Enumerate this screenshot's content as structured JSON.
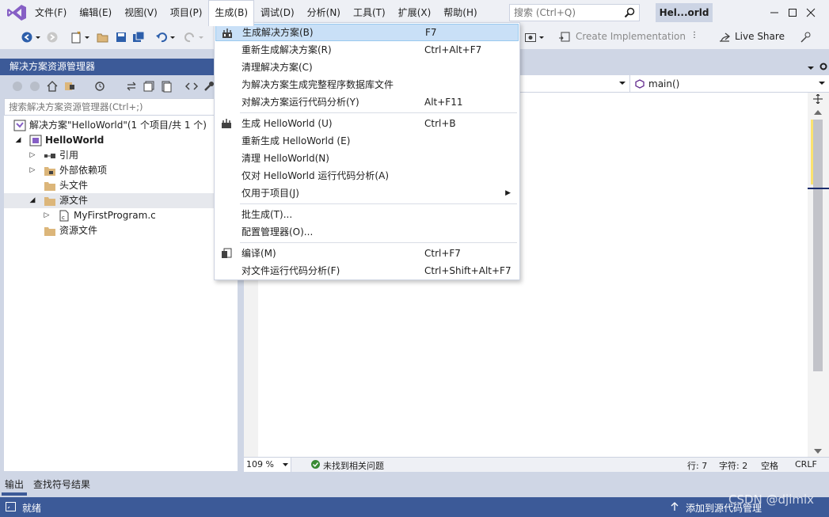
{
  "menu": {
    "items": [
      "文件(F)",
      "编辑(E)",
      "视图(V)",
      "项目(P)",
      "生成(B)",
      "调试(D)",
      "分析(N)",
      "工具(T)",
      "扩展(X)",
      "帮助(H)"
    ],
    "active_index": 4
  },
  "search": {
    "placeholder": "搜索 (Ctrl+Q)"
  },
  "title": "Hel...orld",
  "toolbar": {
    "create_impl": "Create Implementation",
    "live_share": "Live Share"
  },
  "solution_explorer": {
    "title": "解决方案资源管理器",
    "search_placeholder": "搜索解决方案资源管理器(Ctrl+;)",
    "tree": [
      {
        "label": "解决方案\"HelloWorld\"(1 个项目/共 1 个)",
        "icon": "solution-icon",
        "level": 0
      },
      {
        "label": "HelloWorld",
        "icon": "project-icon",
        "level": 0,
        "bold": true,
        "expanded": true
      },
      {
        "label": "引用",
        "icon": "references-icon",
        "level": 1,
        "expandable": true
      },
      {
        "label": "外部依赖项",
        "icon": "external-deps-icon",
        "level": 1,
        "expandable": true
      },
      {
        "label": "头文件",
        "icon": "folder-icon",
        "level": 1
      },
      {
        "label": "源文件",
        "icon": "folder-icon",
        "level": 1,
        "expanded": true,
        "selected": true
      },
      {
        "label": "MyFirstProgram.c",
        "icon": "c-file-icon",
        "level": 2,
        "expandable": true
      },
      {
        "label": "资源文件",
        "icon": "folder-icon",
        "level": 1
      }
    ]
  },
  "build_menu": [
    {
      "label": "生成解决方案(B)",
      "shortcut": "F7",
      "icon": "build-solution-icon",
      "highlighted": true
    },
    {
      "label": "重新生成解决方案(R)",
      "shortcut": "Ctrl+Alt+F7"
    },
    {
      "label": "清理解决方案(C)",
      "shortcut": ""
    },
    {
      "label": "为解决方案生成完整程序数据库文件",
      "shortcut": ""
    },
    {
      "label": "对解决方案运行代码分析(Y)",
      "shortcut": "Alt+F11"
    },
    {
      "separator": true
    },
    {
      "label": "生成 HelloWorld (U)",
      "shortcut": "Ctrl+B",
      "icon": "build-project-icon"
    },
    {
      "label": "重新生成 HelloWorld (E)",
      "shortcut": ""
    },
    {
      "label": "清理 HelloWorld(N)",
      "shortcut": ""
    },
    {
      "label": "仅对 HelloWorld 运行代码分析(A)",
      "shortcut": ""
    },
    {
      "label": "仅用于项目(J)",
      "shortcut": "",
      "submenu": true
    },
    {
      "separator": true
    },
    {
      "label": "批生成(T)...",
      "shortcut": ""
    },
    {
      "label": "配置管理器(O)...",
      "shortcut": ""
    },
    {
      "separator": true
    },
    {
      "label": "编译(M)",
      "shortcut": "Ctrl+F7",
      "icon": "compile-icon"
    },
    {
      "label": "对文件运行代码分析(F)",
      "shortcut": "Ctrl+Shift+Alt+F7"
    }
  ],
  "editor": {
    "function_dropdown": "main()"
  },
  "editor_status": {
    "zoom": "109 %",
    "issues": "未找到相关问题",
    "line": "行: 7",
    "col": "字符: 2",
    "indent": "空格",
    "eol": "CRLF"
  },
  "bottom_tabs": [
    "输出",
    "查找符号结果"
  ],
  "status": {
    "ready": "就绪",
    "source_control": "添加到源代码管理"
  },
  "watermark": "CSDN @djimix",
  "colors": {
    "accent": "#3c5a98",
    "highlight": "#c9e0f7",
    "vs_purple": "#865fc5"
  }
}
